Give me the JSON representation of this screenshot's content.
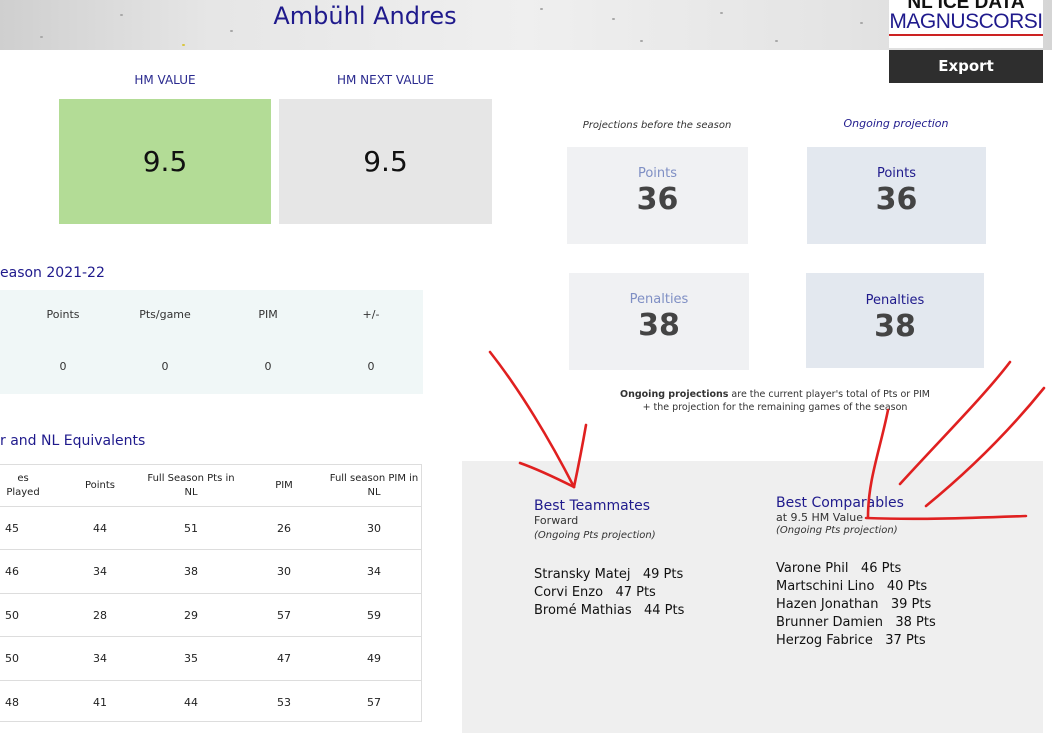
{
  "header": {
    "player_name": "Ambühl Andres",
    "logo_line1": "NL ICE DATA",
    "logo_line2": "MAGNUSCORSI",
    "export_label": "Export"
  },
  "hm": {
    "value_label": "HM VALUE",
    "value": "9.5",
    "value_color": "#b3dc96",
    "next_label": "HM NEXT VALUE",
    "next_value": "9.5",
    "next_color": "#e6e6e6"
  },
  "projections": {
    "before_label": "Projections before the season",
    "ongoing_label": "Ongoing projection",
    "before_points_label": "Points",
    "before_points": "36",
    "ongoing_points_label": "Points",
    "ongoing_points": "36",
    "before_pen_label": "Penalties",
    "before_pen": "38",
    "ongoing_pen_label": "Penalties",
    "ongoing_pen": "38",
    "note_bold": "Ongoing projections",
    "note_rest": " are the current player's total of Pts or PIM",
    "note_line2": "+ the projection for the remaining games of the season"
  },
  "season": {
    "title": "eason 2021-22",
    "headers": [
      "Points",
      "Pts/game",
      "PIM",
      "+/-"
    ],
    "values": [
      "0",
      "0",
      "0",
      "0"
    ]
  },
  "equivalents": {
    "title": "r and NL Equivalents",
    "headers": [
      "es Played",
      "Points",
      "Full Season Pts in NL",
      "PIM",
      "Full season PIM in NL"
    ],
    "rows": [
      [
        "45",
        "44",
        "51",
        "26",
        "30"
      ],
      [
        "46",
        "34",
        "38",
        "30",
        "34"
      ],
      [
        "50",
        "28",
        "29",
        "57",
        "59"
      ],
      [
        "50",
        "34",
        "35",
        "47",
        "49"
      ],
      [
        "48",
        "41",
        "44",
        "53",
        "57"
      ]
    ]
  },
  "teammates": {
    "title": "Best Teammates",
    "subtitle": "Forward",
    "note": "(Ongoing Pts projection)",
    "items": [
      "Stransky Matej   49 Pts",
      "Corvi Enzo   47 Pts",
      "Bromé Mathias   44 Pts"
    ]
  },
  "comparables": {
    "title": "Best Comparables",
    "subtitle": "at 9.5 HM Value",
    "note": "(Ongoing Pts projection)",
    "items": [
      "Varone Phil   46 Pts",
      "Martschini Lino   40 Pts",
      "Hazen Jonathan   39 Pts",
      "Brunner Damien   38 Pts",
      "Herzog Fabrice   37 Pts"
    ]
  },
  "colors": {
    "accent": "#1f1a8c",
    "annotation": "#e02020"
  }
}
